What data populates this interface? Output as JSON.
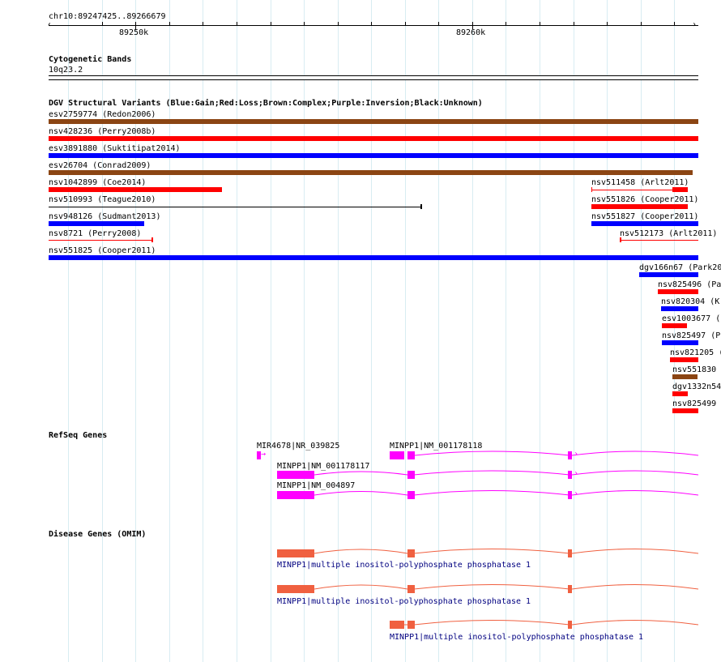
{
  "ruler": {
    "locus": "chr10:89247425..89266679",
    "tick_labels": [
      "89250k",
      "89260k"
    ]
  },
  "cytoband": {
    "title": "Cytogenetic Bands",
    "band": "10q23.2"
  },
  "dgv": {
    "title": "DGV Structural Variants (Blue:Gain;Red:Loss;Brown:Complex;Purple:Inversion;Black:Unknown)",
    "colors": {
      "gain": "#0000ff",
      "loss": "#ff0000",
      "complex": "#8b4513",
      "unknown": "#000000"
    },
    "features": [
      {
        "label": "esv2759774 (Redon2006)",
        "type": "complex"
      },
      {
        "label": "nsv428236 (Perry2008b)",
        "type": "loss"
      },
      {
        "label": "esv3891880 (Suktitipat2014)",
        "type": "gain"
      },
      {
        "label": "esv26704 (Conrad2009)",
        "type": "complex"
      },
      {
        "label": "nsv1042899 (Coe2014)",
        "type": "loss"
      },
      {
        "label": "nsv511458 (Arlt2011)",
        "type": "loss"
      },
      {
        "label": "nsv510993 (Teague2010)",
        "type": "unknown"
      },
      {
        "label": "nsv551826 (Cooper2011)",
        "type": "loss"
      },
      {
        "label": "nsv948126 (Sudmant2013)",
        "type": "gain"
      },
      {
        "label": "nsv551827 (Cooper2011)",
        "type": "gain"
      },
      {
        "label": "nsv8721 (Perry2008)",
        "type": "loss"
      },
      {
        "label": "nsv512173 (Arlt2011)",
        "type": "loss"
      },
      {
        "label": "nsv551825 (Cooper2011)",
        "type": "gain"
      },
      {
        "label": "dgv166n67 (Park20",
        "type": "gain"
      },
      {
        "label": "nsv825496 (Pa",
        "type": "loss"
      },
      {
        "label": "nsv820304 (K",
        "type": "gain"
      },
      {
        "label": "esv1003677 (",
        "type": "loss"
      },
      {
        "label": "nsv825497 (P",
        "type": "gain"
      },
      {
        "label": "nsv821205 (",
        "type": "loss"
      },
      {
        "label": "nsv551830",
        "type": "complex"
      },
      {
        "label": "dgv1332n54",
        "type": "loss"
      },
      {
        "label": "nsv825499",
        "type": "loss"
      }
    ]
  },
  "refseq": {
    "title": "RefSeq Genes",
    "color": "#ff00ff",
    "transcripts": [
      {
        "label": "MIR4678|NR_039825"
      },
      {
        "label": "MINPP1|NM_001178118"
      },
      {
        "label": "MINPP1|NM_001178117"
      },
      {
        "label": "MINPP1|NM_004897"
      }
    ]
  },
  "omim": {
    "title": "Disease Genes (OMIM)",
    "color": "#f06040",
    "transcripts": [
      {
        "label": "MINPP1|multiple inositol-polyphosphate phosphatase 1"
      },
      {
        "label": "MINPP1|multiple inositol-polyphosphate phosphatase 1"
      },
      {
        "label": "MINPP1|multiple inositol-polyphosphate phosphatase 1"
      }
    ]
  }
}
